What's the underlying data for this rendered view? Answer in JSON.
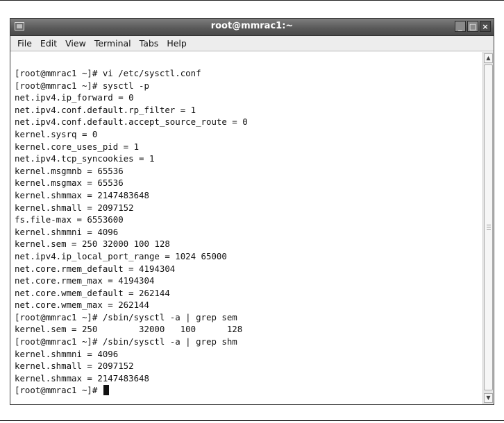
{
  "window": {
    "title": "root@mmrac1:~",
    "buttons": {
      "minimize": "_",
      "maximize": "□",
      "close": "×"
    }
  },
  "menubar": {
    "items": [
      "File",
      "Edit",
      "View",
      "Terminal",
      "Tabs",
      "Help"
    ]
  },
  "terminal": {
    "lines": [
      "[root@mmrac1 ~]# vi /etc/sysctl.conf",
      "[root@mmrac1 ~]# sysctl -p",
      "net.ipv4.ip_forward = 0",
      "net.ipv4.conf.default.rp_filter = 1",
      "net.ipv4.conf.default.accept_source_route = 0",
      "kernel.sysrq = 0",
      "kernel.core_uses_pid = 1",
      "net.ipv4.tcp_syncookies = 1",
      "kernel.msgmnb = 65536",
      "kernel.msgmax = 65536",
      "kernel.shmmax = 2147483648",
      "kernel.shmall = 2097152",
      "fs.file-max = 6553600",
      "kernel.shmmni = 4096",
      "kernel.sem = 250 32000 100 128",
      "net.ipv4.ip_local_port_range = 1024 65000",
      "net.core.rmem_default = 4194304",
      "net.core.rmem_max = 4194304",
      "net.core.wmem_default = 262144",
      "net.core.wmem_max = 262144",
      "[root@mmrac1 ~]# /sbin/sysctl -a | grep sem",
      "kernel.sem = 250        32000   100      128",
      "[root@mmrac1 ~]# /sbin/sysctl -a | grep shm",
      "kernel.shmmni = 4096",
      "kernel.shmall = 2097152",
      "kernel.shmmax = 2147483648"
    ],
    "prompt": "[root@mmrac1 ~]# "
  }
}
